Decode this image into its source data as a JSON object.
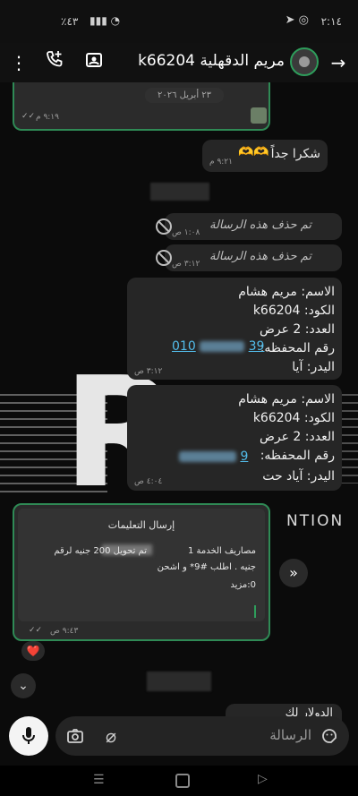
{
  "status_bar": {
    "left_text": "٪٤٣",
    "time": "٢:١٤"
  },
  "header": {
    "contact_name": "مريم الدقهلية k66204"
  },
  "messages": {
    "top_date": "٢٣ أبريل ٢٠٢٦",
    "top_time": "٩:١٩ م",
    "thanks_text": "شكرا جداً",
    "thanks_emojis": "🫶🫶",
    "thanks_time": "٩:٢١ م",
    "deleted_text": "تم حذف هذه الرسالة",
    "deleted1_time": "١:٠٨ ص",
    "deleted2_time": "٣:١٢ ص",
    "info1": {
      "line1": "الاسم: مريم هشام",
      "line2": "الكود: k66204",
      "line3": "العدد: 2 عرض",
      "line4_label": "رقم المحفظه:",
      "line4_value_end": "39",
      "line4_value_start": "010",
      "line5": "اليدر: آيا",
      "time": "٣:١٢ ص"
    },
    "info2": {
      "line1": "الاسم: مريم هشام",
      "line2": "الكود: k66204",
      "line3": "العدد: 2 عرض",
      "line4_label": "رقم المحفظه:",
      "line4_value_end": "9",
      "line5": "اليدر: آياد   حت",
      "time": "٤:٠٤ ص"
    },
    "instructions": {
      "title": "إرسال التعليمات",
      "line1": "تم تحويل 200 جنيه لرقم",
      "line1b": "مصاريف الخدمة 1",
      "line2": "جنيه . اطلب #9* و اشحن",
      "line3": "0:مزيد",
      "time": "٩:٤٣ ص"
    },
    "reaction": "❤️",
    "bottom_partial": "الدولار لك"
  },
  "watermark": {
    "letters": "R",
    "word": "NTION"
  },
  "input": {
    "placeholder": "الرسالة"
  },
  "icons": [
    "arrow-right-icon",
    "more-vert-icon",
    "add-call-icon",
    "contact-card-icon",
    "ban-icon",
    "forward-icon",
    "scroll-down-icon",
    "mic-icon",
    "camera-icon",
    "attach-icon",
    "sticker-icon",
    "read-check-icon"
  ]
}
